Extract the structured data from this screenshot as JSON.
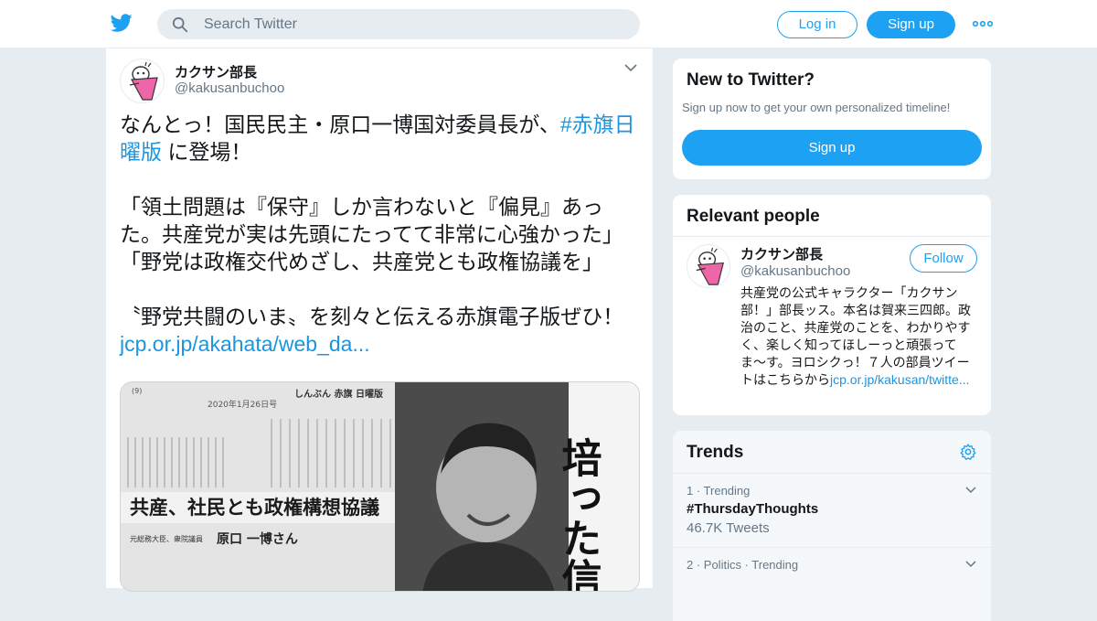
{
  "header": {
    "search_placeholder": "Search Twitter",
    "login_label": "Log in",
    "signup_label": "Sign up"
  },
  "tweet": {
    "name": "カクサン部長",
    "handle": "@kakusanbuchoo",
    "text_part1": "なんとっ！国民民主・原口一博国対委員長が、",
    "hashtag": "#赤旗日曜版",
    "text_part2": " に登場！\n\n「領土問題は『保守』しか言わないと『偏見』あった。共産党が実は先頭にたってて非常に心強かった」\n「野党は政権交代めざし、共産党とも政権協議を」\n\n〝野党共闘のいま〟を刻々と伝える赤旗電子版ぜひ！\n",
    "link": "jcp.or.jp/akahata/web_da...",
    "photo": {
      "newspaper_header": "しんぶん 赤旗 日曜版",
      "date": "2020年1月26日号",
      "headline": "共産、社民とも政権構想協議",
      "byline_role": "元総務大臣、衆院議員",
      "byline_name": "原口 一博さん",
      "big_caption": "培った信"
    }
  },
  "new_to_twitter": {
    "title": "New to Twitter?",
    "subtitle": "Sign up now to get your own personalized timeline!",
    "signup_label": "Sign up"
  },
  "relevant_people": {
    "title": "Relevant people",
    "name": "カクサン部長",
    "handle": "@kakusanbuchoo",
    "follow_label": "Follow",
    "bio": "共産党の公式キャラクター「カクサン部！」部長ッス。本名は賀来三四郎。政治のこと、共産党のことを、わかりやすく、楽しく知ってほしーっと頑張ってま〜す。ヨロシクっ！７人の部員ツイートはこちらから",
    "bio_link": "jcp.or.jp/kakusan/twitte..."
  },
  "trends": {
    "title": "Trends",
    "items": [
      {
        "meta": "1 · Trending",
        "tag": "#ThursdayThoughts",
        "count": "46.7K Tweets"
      },
      {
        "meta": "2 · Politics · Trending",
        "tag": "",
        "count": ""
      }
    ]
  },
  "colors": {
    "accent": "#1da1f2",
    "link": "#1b95e0",
    "muted": "#657786",
    "background": "#e6ecf0"
  }
}
